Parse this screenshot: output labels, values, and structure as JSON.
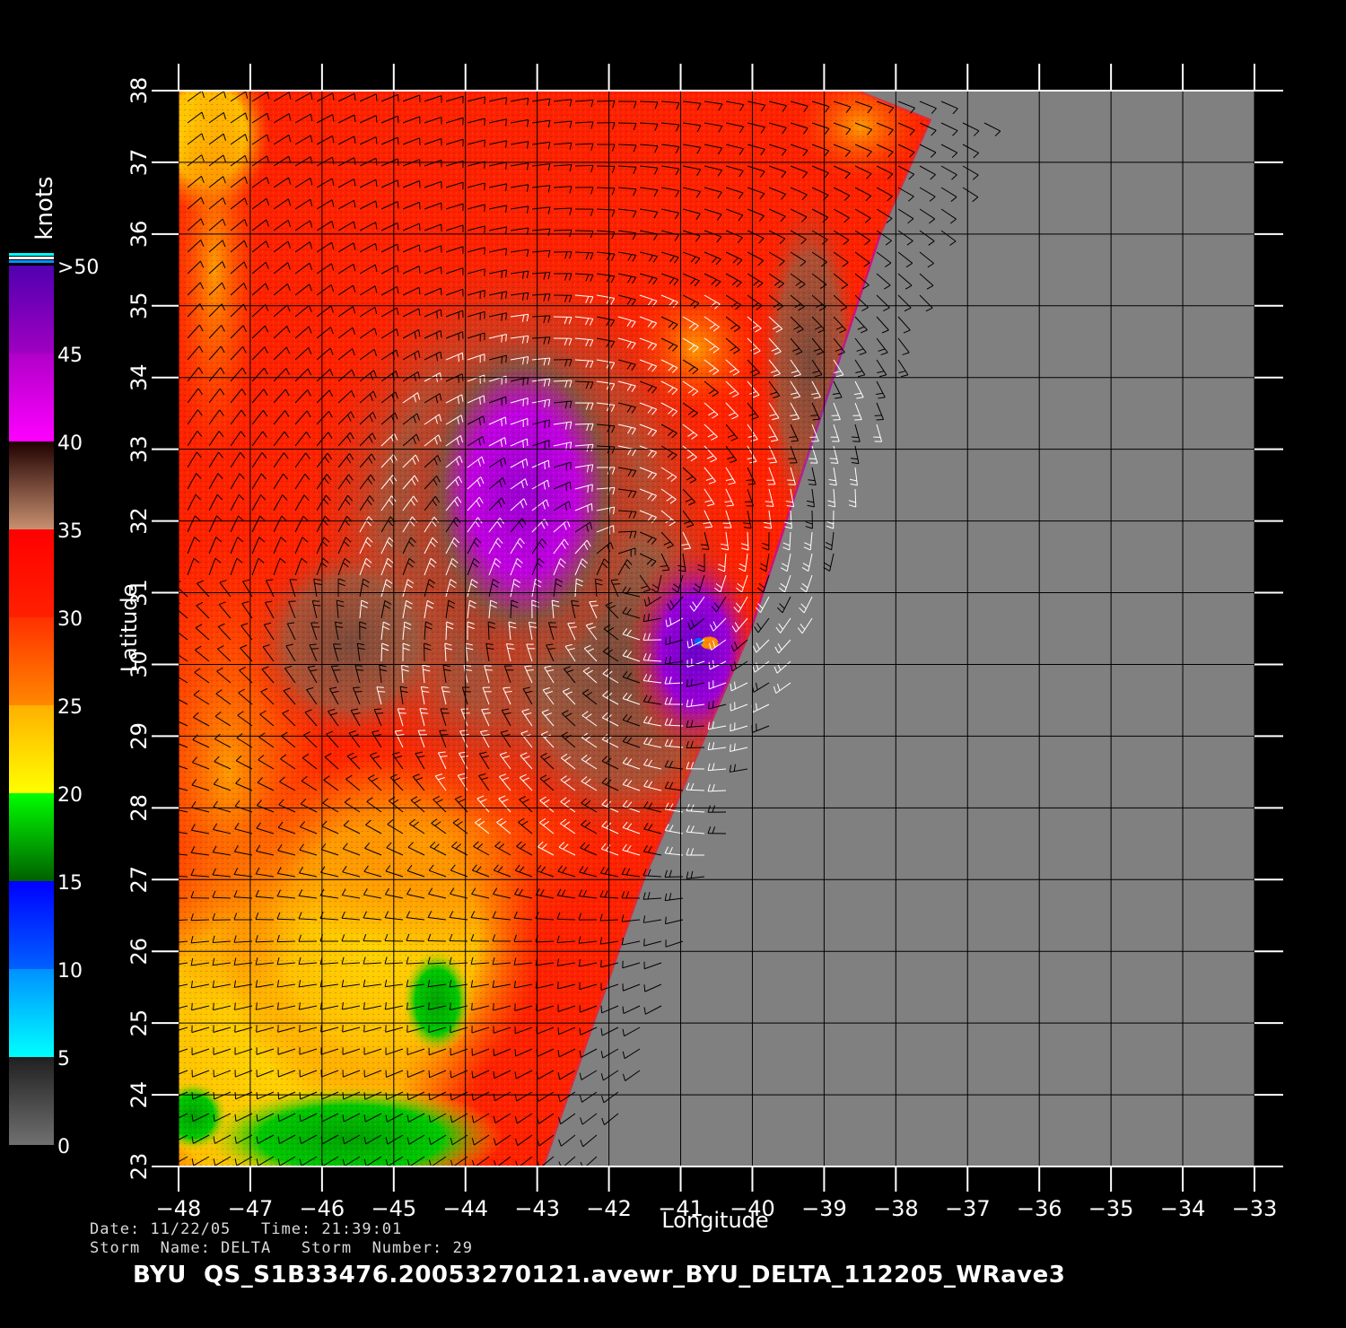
{
  "map": {
    "xlabel": "Longitude",
    "ylabel": "Latitude",
    "lon_ticks": [
      -48,
      -47,
      -46,
      -45,
      -44,
      -43,
      -42,
      -41,
      -40,
      -39,
      -38,
      -37,
      -36,
      -35,
      -34,
      -33
    ],
    "lat_ticks": [
      23,
      24,
      25,
      26,
      27,
      28,
      29,
      30,
      31,
      32,
      33,
      34,
      35,
      36,
      37,
      38
    ],
    "lon_range": [
      -48,
      -33
    ],
    "lat_range": [
      23,
      38
    ],
    "swath_edge": [
      [
        -42.9,
        23
      ],
      [
        -41.5,
        27
      ],
      [
        -40,
        30.5
      ],
      [
        -38.2,
        36
      ],
      [
        -37.5,
        37.6
      ],
      [
        -38.5,
        38
      ]
    ],
    "land_color": "#808080",
    "grid": true
  },
  "colorbar": {
    "unit": "knots",
    "labels": [
      {
        "text": "0",
        "value": 0
      },
      {
        "text": "5",
        "value": 5
      },
      {
        "text": "10",
        "value": 10
      },
      {
        "text": "15",
        "value": 15
      },
      {
        "text": "20",
        "value": 20
      },
      {
        "text": "25",
        "value": 25
      },
      {
        "text": "30",
        "value": 30
      },
      {
        "text": "35",
        "value": 35
      },
      {
        "text": "40",
        "value": 40
      },
      {
        "text": "45",
        "value": 45
      },
      {
        "text": ">50",
        "value": 50
      }
    ],
    "segments": [
      {
        "from": 0,
        "to": 5,
        "colors": [
          "#707070",
          "#202020"
        ]
      },
      {
        "from": 5,
        "to": 10,
        "colors": [
          "#00ffff",
          "#0090ff"
        ]
      },
      {
        "from": 10,
        "to": 15,
        "colors": [
          "#0060ff",
          "#0000ff"
        ]
      },
      {
        "from": 15,
        "to": 20,
        "colors": [
          "#006000",
          "#00ff00"
        ]
      },
      {
        "from": 20,
        "to": 25,
        "colors": [
          "#ffff00",
          "#ffb000"
        ]
      },
      {
        "from": 25,
        "to": 30,
        "colors": [
          "#ff8800",
          "#ff3000"
        ]
      },
      {
        "from": 30,
        "to": 35,
        "colors": [
          "#ff2000",
          "#ff0000"
        ]
      },
      {
        "from": 35,
        "to": 40,
        "colors": [
          "#c89070",
          "#200000"
        ]
      },
      {
        "from": 40,
        "to": 45,
        "colors": [
          "#ff00ff",
          "#b000c8"
        ]
      },
      {
        "from": 45,
        "to": 50,
        "colors": [
          "#a000c0",
          "#5000b0"
        ]
      }
    ],
    "top_stripes": [
      "#00ffff",
      "#ffffff",
      "#0090ff"
    ]
  },
  "footer": {
    "line1": "Date: 11/22/05   Time: 21:39:01",
    "line2": "Storm  Name: DELTA   Storm  Number: 29",
    "title": "BYU  QS_S1B33476.20053270121.avewr_BYU_DELTA_112205_WRave3"
  }
}
